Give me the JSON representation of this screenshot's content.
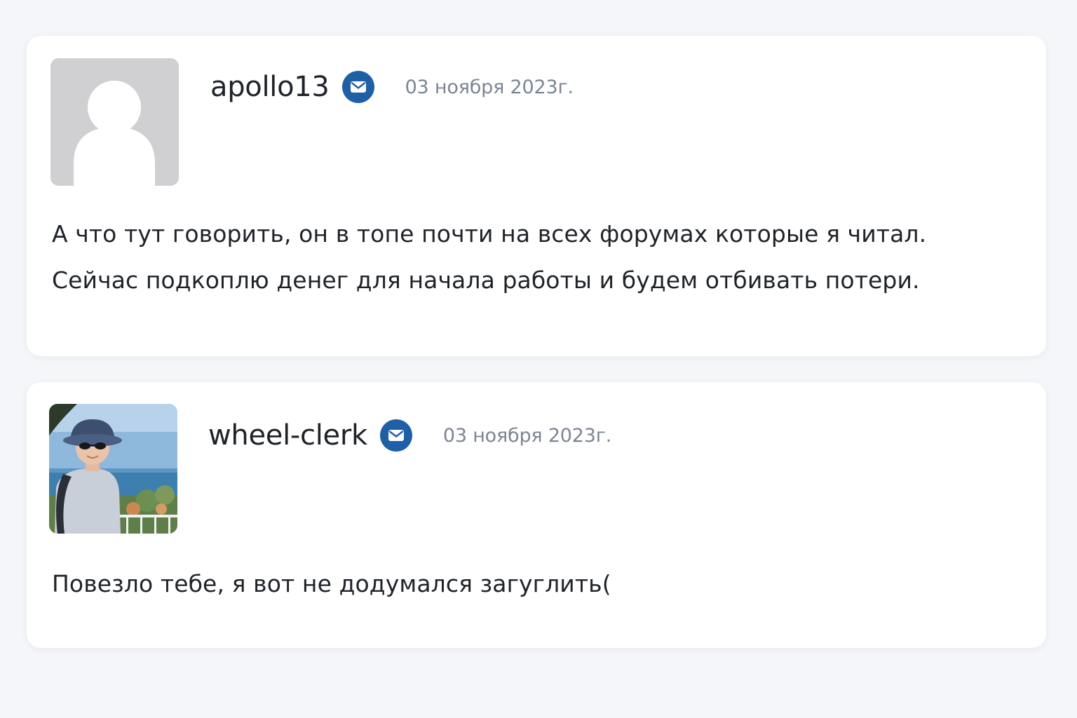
{
  "comments": [
    {
      "author": "apollo13",
      "date": "03 ноября 2023г.",
      "avatar": "default-user-silhouette",
      "badge_icon": "mail-icon",
      "text_lines": [
        "А что тут говорить, он в топе почти на всех форумах которые я читал.",
        "Сейчас подкоплю денег для начала работы и будем отбивать потери."
      ]
    },
    {
      "author": "wheel-clerk",
      "date": "03 ноября 2023г.",
      "avatar": "photo-man-bucket-hat-seaside",
      "badge_icon": "mail-icon",
      "text_lines": [
        "Повезло тебе, я вот не додумался загуглить("
      ]
    }
  ],
  "colors": {
    "page_background": "#f4f6f9",
    "card_background": "#ffffff",
    "badge_blue": "#1e5fa6",
    "date_gray": "#7d8594",
    "text_dark": "#1f2329"
  }
}
